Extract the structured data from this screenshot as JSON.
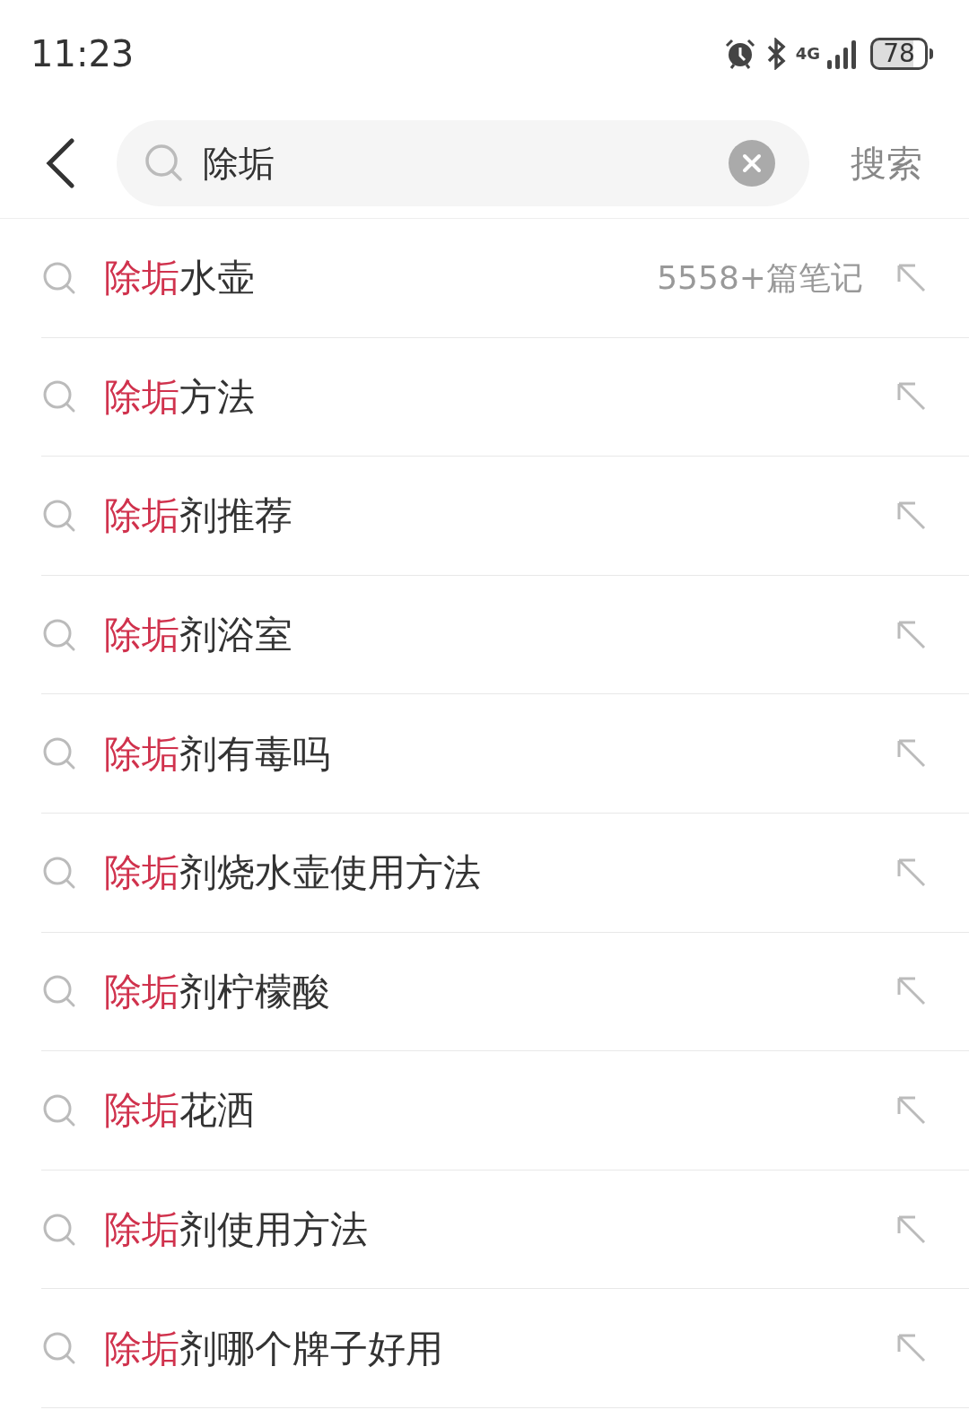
{
  "status_bar": {
    "time": "11:23",
    "network": "4G",
    "battery": "78"
  },
  "search": {
    "value": "除垢",
    "submit": "搜索"
  },
  "suggestions": [
    {
      "match": "除垢",
      "rest": "水壶",
      "count": "5558+篇笔记"
    },
    {
      "match": "除垢",
      "rest": "方法"
    },
    {
      "match": "除垢",
      "rest": "剂推荐"
    },
    {
      "match": "除垢",
      "rest": "剂浴室"
    },
    {
      "match": "除垢",
      "rest": "剂有毒吗"
    },
    {
      "match": "除垢",
      "rest": "剂烧水壶使用方法"
    },
    {
      "match": "除垢",
      "rest": "剂柠檬酸"
    },
    {
      "match": "除垢",
      "rest": "花洒"
    },
    {
      "match": "除垢",
      "rest": "剂使用方法"
    },
    {
      "match": "除垢",
      "rest": "剂哪个牌子好用"
    }
  ]
}
